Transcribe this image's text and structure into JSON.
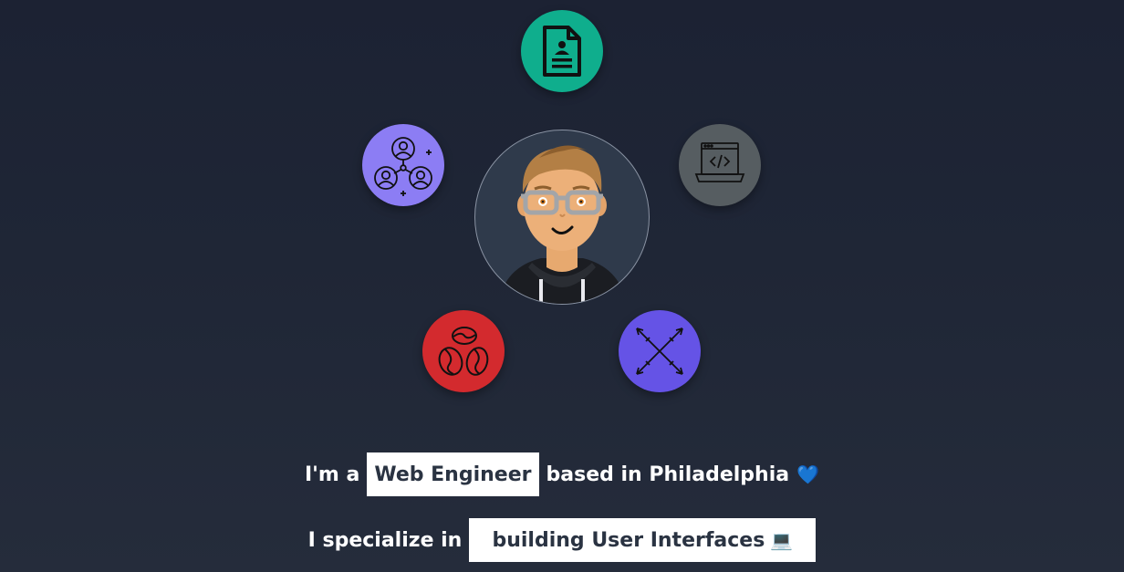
{
  "avatar": {
    "alt": "developer avatar"
  },
  "orbs": {
    "resume": {
      "color": "#0fae8d",
      "icon": "resume-document-icon"
    },
    "team": {
      "color": "#8c7df4",
      "icon": "team-network-icon"
    },
    "code": {
      "color": "#565d61",
      "icon": "laptop-code-icon"
    },
    "coffee": {
      "color": "#d32a2e",
      "icon": "coffee-beans-icon"
    },
    "crossed": {
      "color": "#6553e6",
      "icon": "crossed-arrows-icon"
    }
  },
  "intro": {
    "prefix": "I'm a",
    "role": "Web Engineer",
    "suffix": "based in Philadelphia",
    "emoji": "💙"
  },
  "specialty": {
    "prefix": "I specialize in",
    "value": "building User Interfaces",
    "emoji": "💻"
  }
}
